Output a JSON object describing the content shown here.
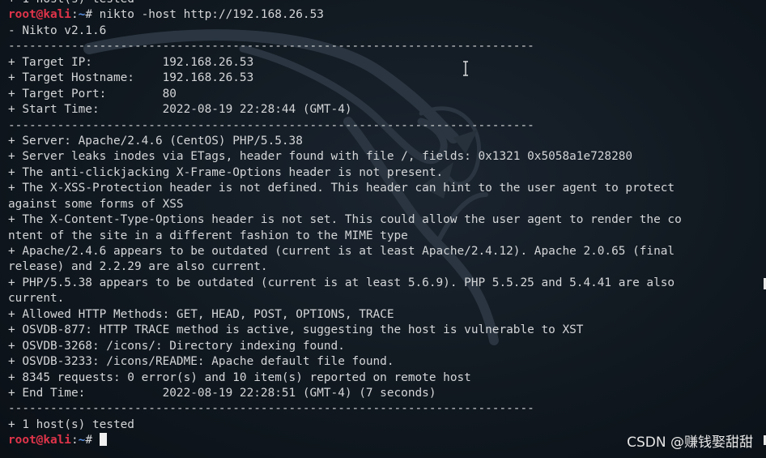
{
  "prompt_top": {
    "user": "root@kali",
    "sep": ":",
    "path": "~",
    "symbol": "# "
  },
  "command": "nikto -host http://192.168.26.53",
  "output": [
    "- Nikto v2.1.6",
    "---------------------------------------------------------------------------",
    "+ Target IP:          192.168.26.53",
    "+ Target Hostname:    192.168.26.53",
    "+ Target Port:        80",
    "+ Start Time:         2022-08-19 22:28:44 (GMT-4)",
    "---------------------------------------------------------------------------",
    "+ Server: Apache/2.4.6 (CentOS) PHP/5.5.38",
    "+ Server leaks inodes via ETags, header found with file /, fields: 0x1321 0x5058a1e728280",
    "+ The anti-clickjacking X-Frame-Options header is not present.",
    "+ The X-XSS-Protection header is not defined. This header can hint to the user agent to protect",
    "against some forms of XSS",
    "+ The X-Content-Type-Options header is not set. This could allow the user agent to render the co",
    "ntent of the site in a different fashion to the MIME type",
    "+ Apache/2.4.6 appears to be outdated (current is at least Apache/2.4.12). Apache 2.0.65 (final",
    "release) and 2.2.29 are also current.",
    "+ PHP/5.5.38 appears to be outdated (current is at least 5.6.9). PHP 5.5.25 and 5.4.41 are also",
    "current.",
    "+ Allowed HTTP Methods: GET, HEAD, POST, OPTIONS, TRACE",
    "+ OSVDB-877: HTTP TRACE method is active, suggesting the host is vulnerable to XST",
    "+ OSVDB-3268: /icons/: Directory indexing found.",
    "+ OSVDB-3233: /icons/README: Apache default file found.",
    "+ 8345 requests: 0 error(s) and 10 item(s) reported on remote host",
    "+ End Time:           2022-08-19 22:28:51 (GMT-4) (7 seconds)",
    "---------------------------------------------------------------------------",
    "+ 1 host(s) tested"
  ],
  "prompt_bottom": {
    "user": "root@kali",
    "sep": ":",
    "path": "~",
    "symbol": "# "
  },
  "watermark": "CSDN @赚钱娶甜甜",
  "colors": {
    "background": "#121a22",
    "text": "#d4d6d8",
    "prompt_user": "#e0344a",
    "prompt_path": "#5a8fe0"
  },
  "icons": [
    "kali-dragon-logo-icon",
    "text-cursor-ibeam-icon"
  ]
}
